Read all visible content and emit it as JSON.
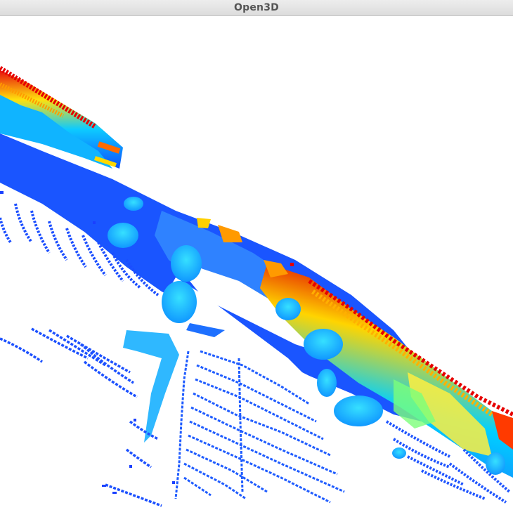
{
  "window": {
    "title": "Open3D"
  },
  "viewport": {
    "background": "#ffffff",
    "content": "point-cloud",
    "colormap": [
      "#1a1aff",
      "#0066ff",
      "#00c8ff",
      "#8cff6e",
      "#ffe000",
      "#ff6000",
      "#e60000"
    ]
  }
}
